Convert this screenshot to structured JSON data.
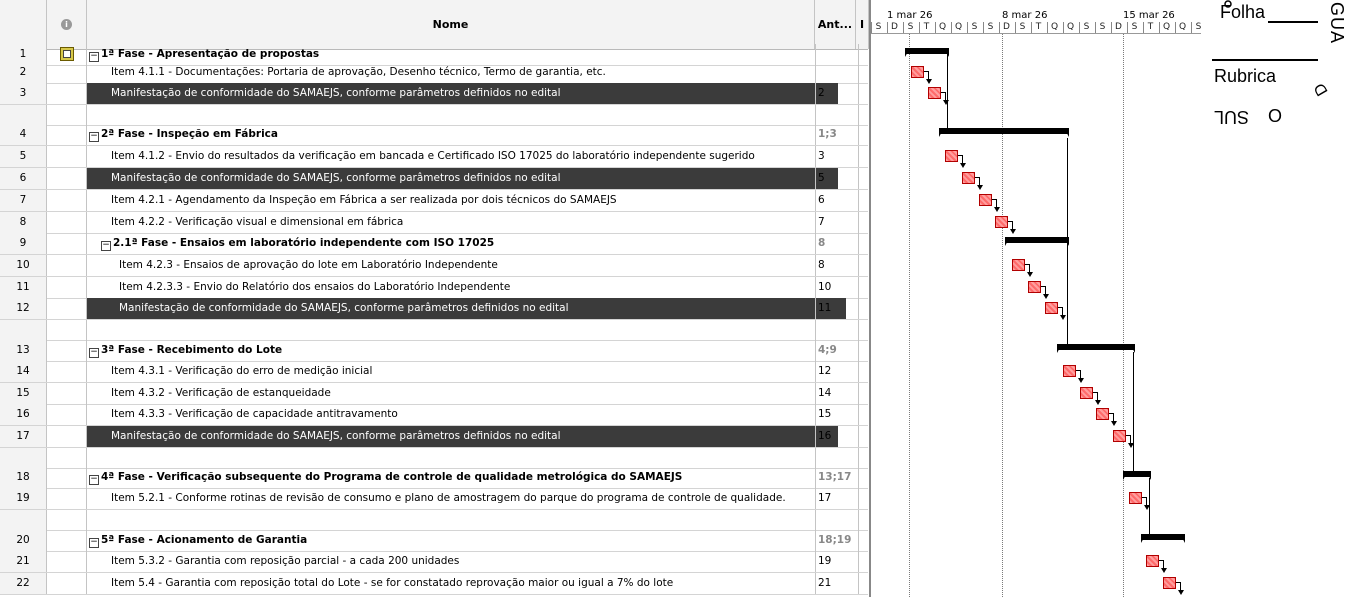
{
  "header": {
    "nome": "Nome",
    "ant": "Ant...",
    "ant2": "I"
  },
  "rows": [
    {
      "id": "1",
      "name": "1ª Fase - Apresentação de propostas",
      "pred": "",
      "summary": true,
      "dark": false,
      "indent": 0,
      "icon": true
    },
    {
      "id": "2",
      "name": "Item 4.1.1 - Documentações: Portaria de aprovação, Desenho técnico, Termo de garantia, etc.",
      "pred": "",
      "summary": false,
      "dark": false,
      "indent": 1
    },
    {
      "id": "3",
      "name": "Manifestação de conformidade do SAMAEJS, conforme parâmetros definidos no edital",
      "pred": "2",
      "summary": false,
      "dark": true,
      "indent": 1
    },
    {
      "id": "4",
      "name": "2ª Fase - Inspeção em Fábrica",
      "pred": "1;3",
      "summary": true,
      "dark": false,
      "indent": 0
    },
    {
      "id": "5",
      "name": "Item 4.1.2 - Envio do resultados da verificação em bancada e Certificado ISO 17025 do laboratório independente sugerido",
      "pred": "3",
      "summary": false,
      "dark": false,
      "indent": 1
    },
    {
      "id": "6",
      "name": "Manifestação de conformidade do SAMAEJS, conforme parâmetros definidos no edital",
      "pred": "5",
      "summary": false,
      "dark": true,
      "indent": 1
    },
    {
      "id": "7",
      "name": "Item 4.2.1 - Agendamento da Inspeção em Fábrica a ser realizada por dois técnicos do SAMAEJS",
      "pred": "6",
      "summary": false,
      "dark": false,
      "indent": 1
    },
    {
      "id": "8",
      "name": "Item 4.2.2 - Verificação visual e dimensional em fábrica",
      "pred": "7",
      "summary": false,
      "dark": false,
      "indent": 1
    },
    {
      "id": "9",
      "name": "2.1ª Fase - Ensaios em laboratório independente com ISO 17025",
      "pred": "8",
      "summary": true,
      "dark": false,
      "indent": 1
    },
    {
      "id": "10",
      "name": "Item 4.2.3 - Ensaios de aprovação do lote em Laboratório Independente",
      "pred": "8",
      "summary": false,
      "dark": false,
      "indent": 2
    },
    {
      "id": "11",
      "name": "Item 4.2.3.3 - Envio do Relatório dos ensaios do Laboratório Independente",
      "pred": "10",
      "summary": false,
      "dark": false,
      "indent": 2
    },
    {
      "id": "12",
      "name": "Manifestação de conformidade do SAMAEJS, conforme parâmetros definidos no edital",
      "pred": "11",
      "summary": false,
      "dark": true,
      "indent": 2
    },
    {
      "id": "13",
      "name": "3ª Fase - Recebimento do Lote",
      "pred": "4;9",
      "summary": true,
      "dark": false,
      "indent": 0
    },
    {
      "id": "14",
      "name": "Item 4.3.1 - Verificação do erro de medição inicial",
      "pred": "12",
      "summary": false,
      "dark": false,
      "indent": 1
    },
    {
      "id": "15",
      "name": "Item 4.3.2 - Verificação de estanqueidade",
      "pred": "14",
      "summary": false,
      "dark": false,
      "indent": 1
    },
    {
      "id": "16",
      "name": "Item 4.3.3 - Verificação de capacidade antitravamento",
      "pred": "15",
      "summary": false,
      "dark": false,
      "indent": 1
    },
    {
      "id": "17",
      "name": "Manifestação de conformidade do SAMAEJS, conforme parâmetros definidos no edital",
      "pred": "16",
      "summary": false,
      "dark": true,
      "indent": 1
    },
    {
      "id": "18",
      "name": "4ª Fase - Verificação subsequente do Programa de controle de qualidade metrológica do SAMAEJS",
      "pred": "13;17",
      "summary": true,
      "dark": false,
      "indent": 0
    },
    {
      "id": "19",
      "name": "Item 5.2.1 - Conforme rotinas de revisão de consumo e plano de amostragem do parque do programa de controle de qualidade.",
      "pred": "17",
      "summary": false,
      "dark": false,
      "indent": 1
    },
    {
      "id": "20",
      "name": "5ª Fase - Acionamento de Garantia",
      "pred": "18;19",
      "summary": true,
      "dark": false,
      "indent": 0
    },
    {
      "id": "21",
      "name": "Item 5.3.2 - Garantia com reposição parcial - a cada 200 unidades",
      "pred": "19",
      "summary": false,
      "dark": false,
      "indent": 1
    },
    {
      "id": "22",
      "name": "Item 5.4 - Garantia com reposição total do Lote - se for constatado reprovação maior ou igual a 7% do lote",
      "pred": "21",
      "summary": false,
      "dark": false,
      "indent": 1
    }
  ],
  "timescale": {
    "weeks": [
      "1 mar 26",
      "8 mar 26",
      "15 mar 26"
    ],
    "days": [
      "S",
      "D",
      "S",
      "T",
      "Q",
      "Q",
      "S",
      "S",
      "D",
      "S",
      "T",
      "Q",
      "Q",
      "S",
      "S",
      "D",
      "S",
      "T",
      "Q",
      "Q",
      "S"
    ]
  },
  "stamp": {
    "folha": "Folha",
    "rubrica": "Rubrica",
    "arc_top": "GUA",
    "arc_bottom": "SUL",
    "arc_o": "O",
    "arc_d": "D"
  },
  "colors": {
    "task_fill": "#ff6b6b",
    "dark_row": "#3b3b3b",
    "summary_bar": "#000000"
  }
}
